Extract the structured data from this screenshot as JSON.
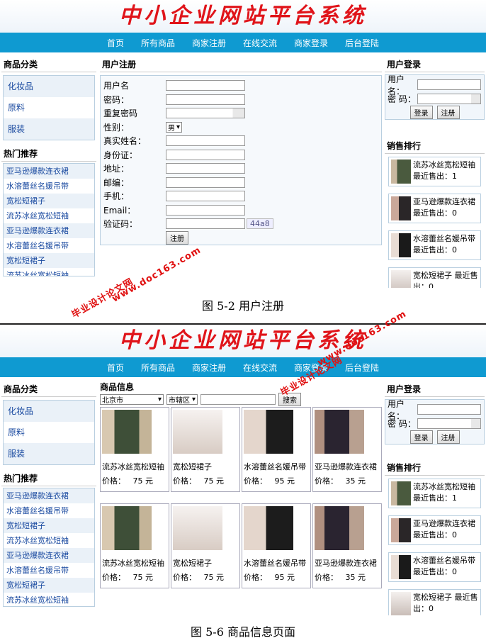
{
  "site_title": "中小企业网站平台系统",
  "nav": [
    "首页",
    "所有商品",
    "商家注册",
    "在线交流",
    "商家登录",
    "后台登陆"
  ],
  "categories": {
    "title": "商品分类",
    "items": [
      "化妆品",
      "原料",
      "服装"
    ]
  },
  "hot": {
    "title": "热门推荐",
    "items": [
      "亚马逊爆款连衣裙",
      "水溶蕾丝名媛吊带",
      "宽松短裙子",
      "流苏冰丝宽松短袖",
      "亚马逊爆款连衣裙",
      "水溶蕾丝名媛吊带",
      "宽松短裙子",
      "流苏冰丝宽松短袖"
    ]
  },
  "register": {
    "title": "用户注册",
    "fields": [
      "用户名",
      "密码：",
      "重复密码",
      "性别：",
      "真实姓名：",
      "身份证：",
      "地址：",
      "邮编：",
      "手机：",
      "Email：",
      "验证码："
    ],
    "gender_value": "男",
    "captcha": "44a8",
    "submit": "注册"
  },
  "login": {
    "title": "用户登录",
    "username_label": "用户名：",
    "password_label": "密  码：",
    "login_btn": "登录",
    "register_btn": "注册"
  },
  "ranking": {
    "title": "销售排行",
    "items": [
      {
        "name": "流苏冰丝宽松短袖",
        "sold": "最近售出：1"
      },
      {
        "name": "亚马逊爆款连衣裙",
        "sold": "最近售出：0"
      },
      {
        "name": "水溶蕾丝名媛吊带",
        "sold": "最近售出：0"
      },
      {
        "name": "宽松短裙子",
        "sold": "最近售出：0"
      }
    ]
  },
  "products": {
    "title": "商品信息",
    "city": "北京市",
    "district": "市辖区",
    "search_btn": "搜索",
    "price_label": "价格：",
    "unit": "元",
    "items": [
      {
        "name": "流苏冰丝宽松短袖",
        "price": "75"
      },
      {
        "name": "宽松短裙子",
        "price": "75"
      },
      {
        "name": "水溶蕾丝名媛吊带",
        "price": "95"
      },
      {
        "name": "亚马逊爆款连衣裙",
        "price": "35"
      }
    ]
  },
  "captions": [
    "图 5-2 用户注册",
    "图 5-6 商品信息页面"
  ],
  "watermarks": [
    "毕业设计论文网",
    "www.doc163.com"
  ],
  "colors": {
    "nav": "#0f9ad1",
    "title": "#e0141a",
    "link": "#1a4aa0"
  }
}
